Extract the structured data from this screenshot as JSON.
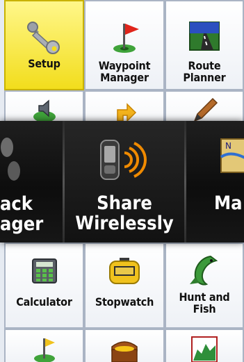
{
  "grid": {
    "row1": [
      {
        "label": "Setup",
        "icon": "wrench-icon",
        "selected": true
      },
      {
        "label_lines": [
          "Waypoint",
          "Manager"
        ],
        "icon": "waypoint-flag-icon"
      },
      {
        "label_lines": [
          "Route",
          "Planner"
        ],
        "icon": "road-icon"
      }
    ],
    "row2_icons": [
      "speaker-icon",
      "turn-arrow-icon",
      "pencil-icon"
    ],
    "row3": [
      {
        "label": "Calculator",
        "icon": "calculator-icon"
      },
      {
        "label": "Stopwatch",
        "icon": "stopwatch-icon"
      },
      {
        "label_lines": [
          "Hunt and",
          "Fish"
        ],
        "icon": "fish-icon"
      }
    ],
    "row4_icons": [
      "golf-flag-icon",
      "treasure-chest-icon",
      "elevation-plot-icon"
    ]
  },
  "carousel": {
    "left": {
      "lines": [
        "ack",
        "ager"
      ],
      "icon": "footprints-icon"
    },
    "center": {
      "lines": [
        "Share",
        "Wirelessly"
      ],
      "icon": "wireless-device-icon"
    },
    "right": {
      "lines": [
        "Ma"
      ],
      "icon": "map-icon"
    }
  },
  "colors": {
    "selected_tile": "#f6e43a",
    "tile_border": "#aab4c4",
    "wireless_orange": "#f08a00",
    "carousel_background": "#111111"
  }
}
